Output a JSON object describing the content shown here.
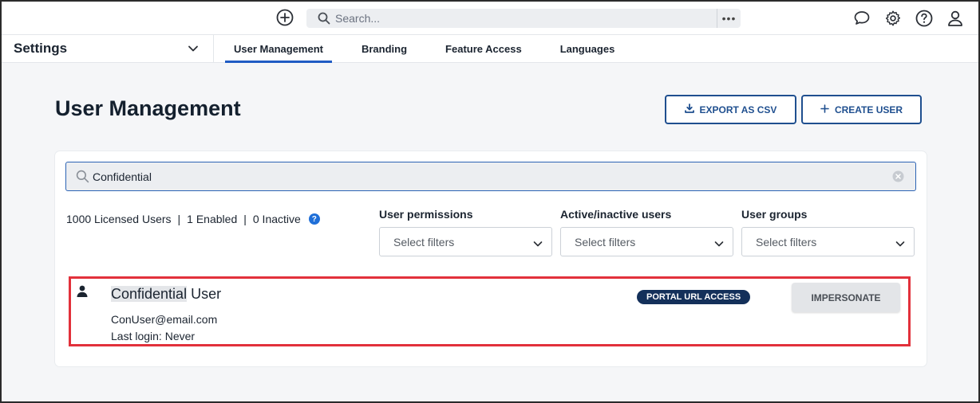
{
  "topbar": {
    "search_placeholder": "Search...",
    "more_label": "•••",
    "icons": [
      "add-icon",
      "search-icon",
      "chat-icon",
      "gear-icon",
      "help-icon",
      "user-icon"
    ]
  },
  "subnav": {
    "settings_label": "Settings",
    "tabs": [
      {
        "label": "User Management",
        "active": true
      },
      {
        "label": "Branding",
        "active": false
      },
      {
        "label": "Feature Access",
        "active": false
      },
      {
        "label": "Languages",
        "active": false
      }
    ]
  },
  "page": {
    "title": "User Management",
    "export_label": "EXPORT AS CSV",
    "create_label": "CREATE USER"
  },
  "user_search": {
    "value": "Confidential"
  },
  "counts": {
    "licensed": "1000 Licensed Users",
    "separator": "|",
    "enabled": "1 Enabled",
    "inactive": "0 Inactive",
    "help": "?"
  },
  "filters": [
    {
      "label": "User permissions",
      "placeholder": "Select filters"
    },
    {
      "label": "Active/inactive users",
      "placeholder": "Select filters"
    },
    {
      "label": "User groups",
      "placeholder": "Select filters"
    }
  ],
  "user": {
    "name_highlight": "Confidential",
    "name_rest": " User",
    "email": "ConUser@email.com",
    "last_login": "Last login: Never",
    "badge": "PORTAL URL ACCESS",
    "impersonate_label": "IMPERSONATE"
  },
  "colors": {
    "accent": "#1f5bc4",
    "button_outline": "#1f4f8f",
    "badge_bg": "#14305a",
    "highlight_border": "#e2313b"
  }
}
